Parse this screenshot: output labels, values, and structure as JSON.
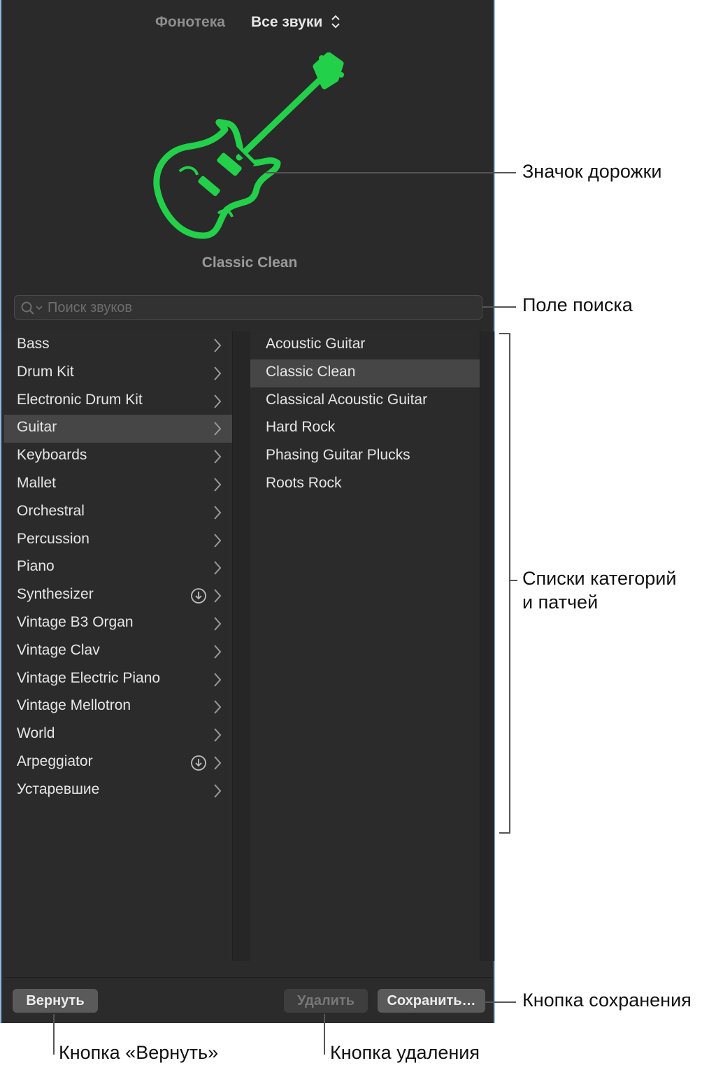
{
  "header": {
    "library_tab": "Фонотека",
    "sounds_selector": "Все звуки",
    "patch_name": "Classic Clean",
    "track_icon": "guitar-icon",
    "icon_color": "#22d04a"
  },
  "search": {
    "placeholder": "Поиск звуков"
  },
  "categories": [
    {
      "label": "Bass"
    },
    {
      "label": "Drum Kit"
    },
    {
      "label": "Electronic Drum Kit"
    },
    {
      "label": "Guitar"
    },
    {
      "label": "Keyboards"
    },
    {
      "label": "Mallet"
    },
    {
      "label": "Orchestral"
    },
    {
      "label": "Percussion"
    },
    {
      "label": "Piano"
    },
    {
      "label": "Synthesizer"
    },
    {
      "label": "Vintage B3 Organ"
    },
    {
      "label": "Vintage Clav"
    },
    {
      "label": "Vintage Electric Piano"
    },
    {
      "label": "Vintage Mellotron"
    },
    {
      "label": "World"
    },
    {
      "label": "Arpeggiator"
    },
    {
      "label": "Устаревшие"
    }
  ],
  "selected_category": "Guitar",
  "download_categories": [
    "Synthesizer",
    "Arpeggiator"
  ],
  "patches": [
    {
      "label": "Acoustic Guitar"
    },
    {
      "label": "Classic Clean"
    },
    {
      "label": "Classical Acoustic Guitar"
    },
    {
      "label": "Hard Rock"
    },
    {
      "label": "Phasing Guitar Plucks"
    },
    {
      "label": "Roots Rock"
    }
  ],
  "selected_patch": "Classic Clean",
  "footer": {
    "revert_label": "Вернуть",
    "delete_label": "Удалить",
    "save_label": "Сохранить…"
  },
  "callouts": {
    "track_icon": "Значок дорожки",
    "search_field": "Поле поиска",
    "lists_line1": "Списки категорий",
    "lists_line2": "и патчей",
    "save_button": "Кнопка сохранения",
    "revert_button": "Кнопка «Вернуть»",
    "delete_button": "Кнопка удаления"
  }
}
